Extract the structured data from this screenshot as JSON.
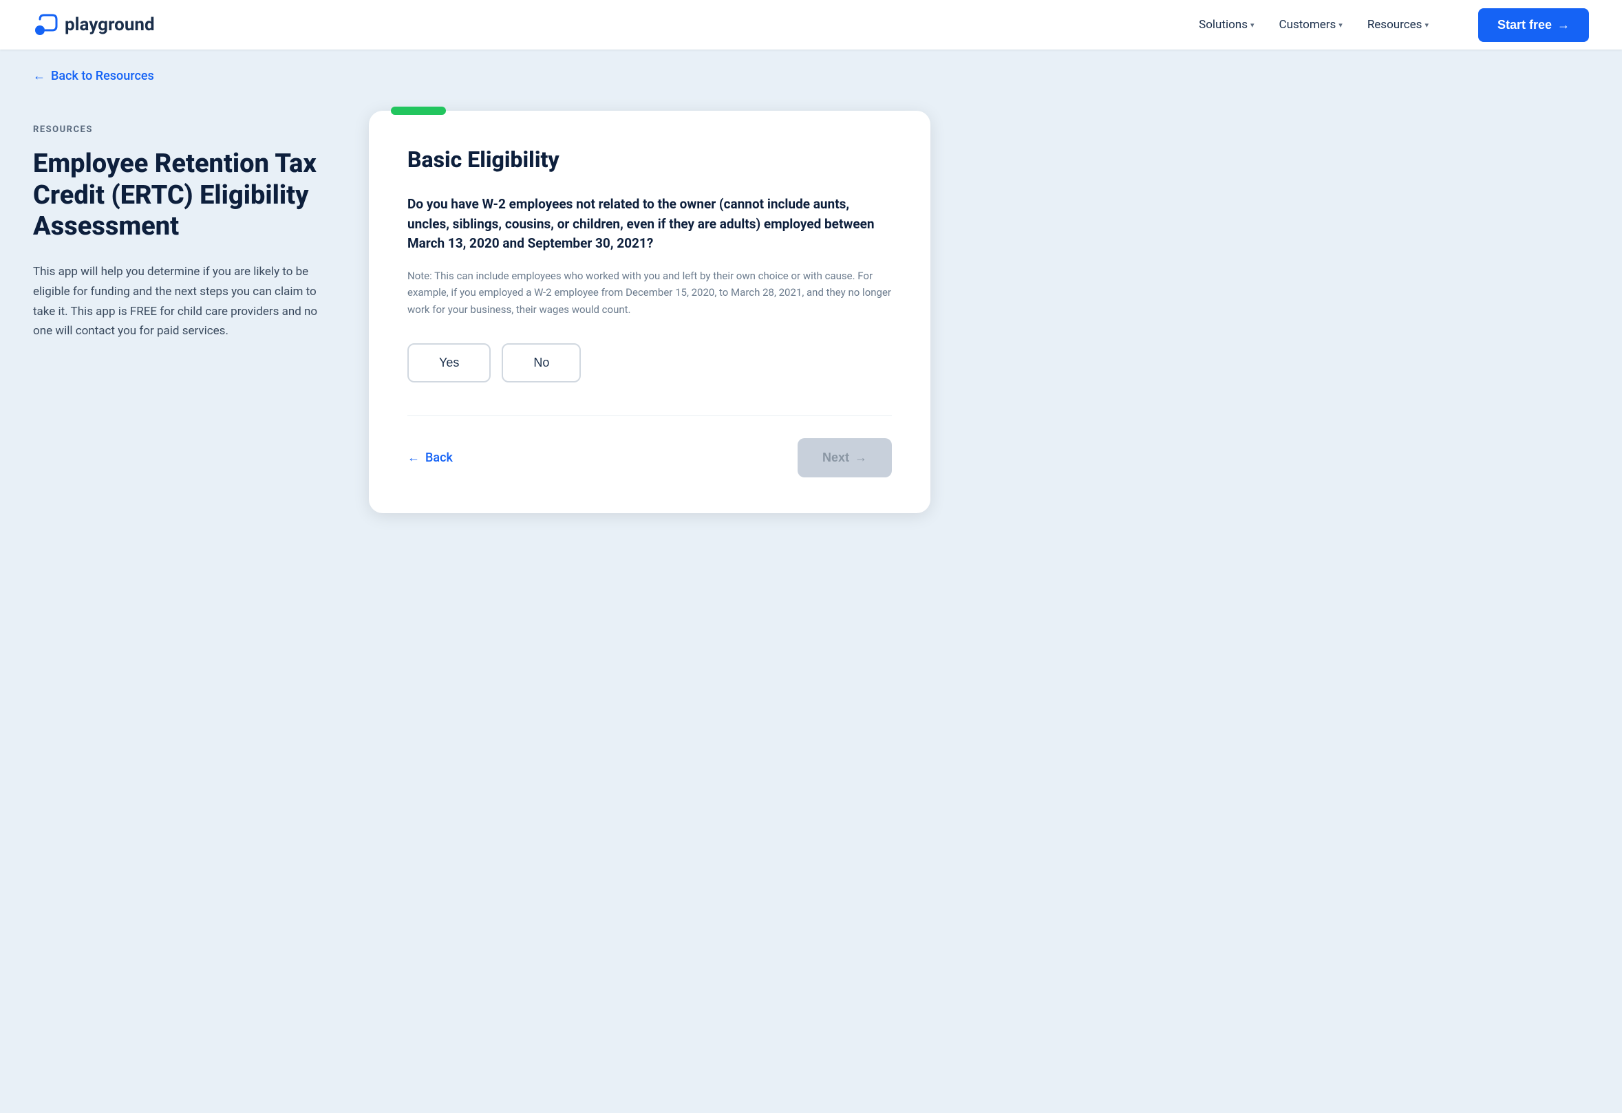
{
  "nav": {
    "logo_text": "playground",
    "links": [
      {
        "label": "Solutions",
        "has_dropdown": true
      },
      {
        "label": "Customers",
        "has_dropdown": true
      },
      {
        "label": "Resources",
        "has_dropdown": true
      }
    ],
    "cta_label": "Start free",
    "cta_arrow": "→"
  },
  "back_link": {
    "label": "Back to Resources",
    "arrow": "←"
  },
  "left": {
    "resources_label": "RESOURCES",
    "page_title": "Employee Retention Tax Credit (ERTC) Eligibility Assessment",
    "page_description": "This app will help you determine if you are likely to be eligible for funding and the next steps you can claim to take it. This app is FREE for child care providers and no one will contact you for paid services."
  },
  "card": {
    "section_title": "Basic Eligibility",
    "question": "Do you have W-2 employees not related to the owner (cannot include aunts, uncles, siblings, cousins, or children, even if they are adults) employed between March 13, 2020 and September 30, 2021?",
    "note": "Note: This can include employees who worked with you and left by their own choice or with cause. For example, if you employed a W-2 employee from December 15, 2020, to March 28, 2021, and they no longer work for your business, their wages would count.",
    "answer_yes": "Yes",
    "answer_no": "No",
    "footer_back_arrow": "←",
    "footer_back_label": "Back",
    "footer_next_label": "Next",
    "footer_next_arrow": "→"
  }
}
